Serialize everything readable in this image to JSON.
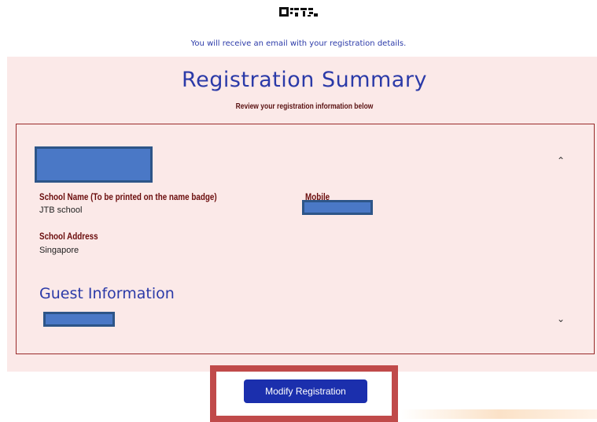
{
  "header": {
    "qr_icon": "qr-code-icon",
    "notice": "You will receive an email with your registration details."
  },
  "summary": {
    "title": "Registration Summary",
    "subtitle": "Review your registration information below"
  },
  "registrant": {
    "school_name_label": "School Name (To be printed on the name badge)",
    "school_name_value": "JTB school",
    "mobile_label": "Mobile",
    "school_address_label": "School Address",
    "school_address_value": "Singapore",
    "collapse_icon": "chevron-up-icon"
  },
  "guest": {
    "title": "Guest Information",
    "expand_icon": "chevron-down-icon"
  },
  "actions": {
    "modify_label": "Modify Registration"
  },
  "colors": {
    "accent": "#2b3aa8",
    "panel_bg": "#fbe9e8",
    "label": "#6a0c0c",
    "button": "#1b2fad",
    "highlight": "#c04a4a",
    "redaction": "#4a78c6"
  }
}
